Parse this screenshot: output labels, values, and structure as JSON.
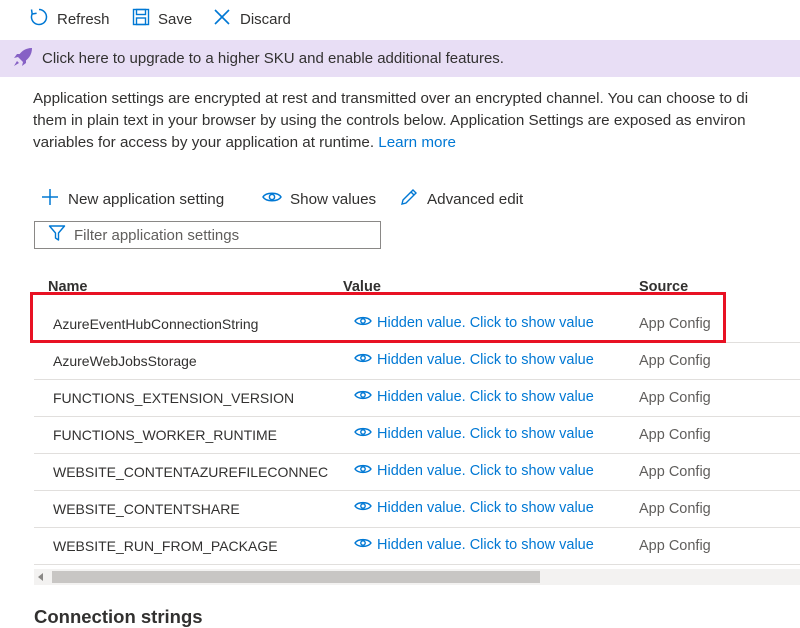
{
  "toolbar": {
    "refresh_label": "Refresh",
    "save_label": "Save",
    "discard_label": "Discard"
  },
  "banner": {
    "text": "Click here to upgrade to a higher SKU and enable additional features."
  },
  "description": {
    "line1": "Application settings are encrypted at rest and transmitted over an encrypted channel. You can choose to di",
    "line2": "them in plain text in your browser by using the controls below. Application Settings are exposed as environ",
    "line3": "variables for access by your application at runtime.",
    "link": "Learn more"
  },
  "commands": {
    "new_label": "New application setting",
    "show_values_label": "Show values",
    "advanced_edit_label": "Advanced edit"
  },
  "filter": {
    "placeholder": "Filter application settings",
    "value": ""
  },
  "table": {
    "columns": [
      "Name",
      "Value",
      "Source"
    ],
    "rows": [
      {
        "name": "AzureEventHubConnectionString",
        "value": "Hidden value. Click to show value",
        "source": "App Config"
      },
      {
        "name": "AzureWebJobsStorage",
        "value": "Hidden value. Click to show value",
        "source": "App Config"
      },
      {
        "name": "FUNCTIONS_EXTENSION_VERSION",
        "value": "Hidden value. Click to show value",
        "source": "App Config"
      },
      {
        "name": "FUNCTIONS_WORKER_RUNTIME",
        "value": "Hidden value. Click to show value",
        "source": "App Config"
      },
      {
        "name": "WEBSITE_CONTENTAZUREFILECONNECTIONSTRING",
        "value": "Hidden value. Click to show value",
        "source": "App Config"
      },
      {
        "name": "WEBSITE_CONTENTSHARE",
        "value": "Hidden value. Click to show value",
        "source": "App Config"
      },
      {
        "name": "WEBSITE_RUN_FROM_PACKAGE",
        "value": "Hidden value. Click to show value",
        "source": "App Config"
      }
    ]
  },
  "section_heading": "Connection strings",
  "colors": {
    "accent": "#0078d4",
    "banner_bg": "#e8def5",
    "highlight": "#e81123",
    "rocket": "#8661c5"
  },
  "icons": {
    "refresh": "refresh-icon",
    "save": "save-icon",
    "discard": "close-icon",
    "rocket": "rocket-icon",
    "add": "plus-icon",
    "eye": "eye-icon",
    "edit": "pencil-icon",
    "filter": "funnel-icon"
  }
}
